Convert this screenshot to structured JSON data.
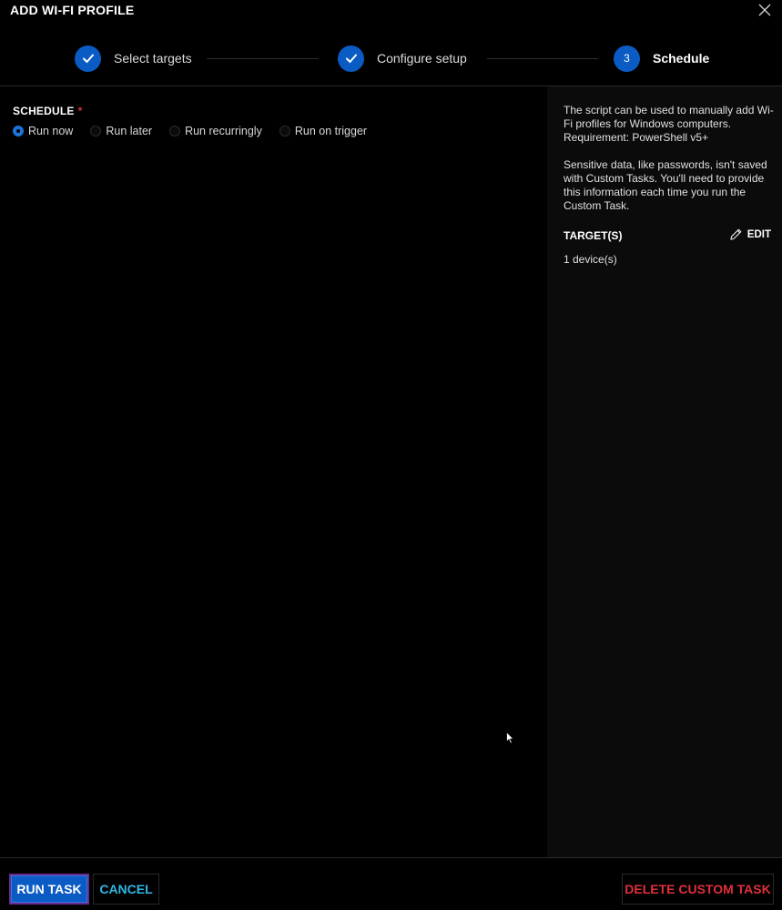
{
  "header": {
    "title": "ADD WI-FI PROFILE"
  },
  "stepper": {
    "steps": [
      {
        "label": "Select targets",
        "status": "complete"
      },
      {
        "label": "Configure setup",
        "status": "complete"
      },
      {
        "label": "Schedule",
        "number": "3",
        "status": "active"
      }
    ]
  },
  "schedule": {
    "label": "SCHEDULE",
    "required_marker": "*",
    "options": [
      {
        "label": "Run now",
        "selected": true
      },
      {
        "label": "Run later",
        "selected": false
      },
      {
        "label": "Run recurringly",
        "selected": false
      },
      {
        "label": "Run on trigger",
        "selected": false
      }
    ]
  },
  "side_panel": {
    "description": "The script can be used to manually add Wi-Fi profiles for Windows computers. Requirement: PowerShell v5+",
    "sensitive_note": "Sensitive data, like passwords, isn't saved with Custom Tasks. You'll need to provide this information each time you run the Custom Task.",
    "targets_title": "TARGET(S)",
    "edit_label": "EDIT",
    "targets_count": "1 device(s)"
  },
  "footer": {
    "run_label": "RUN TASK",
    "cancel_label": "CANCEL",
    "delete_label": "DELETE CUSTOM TASK"
  },
  "colors": {
    "accent": "#0a5bc4",
    "cancel": "#2fb8e6",
    "danger": "#e0303a",
    "background": "#000000",
    "side_background": "#0b0b0c"
  },
  "icons": {
    "close": "close-icon",
    "step_complete": "check-icon",
    "edit": "pencil-icon",
    "cursor": "mouse-cursor-icon"
  }
}
